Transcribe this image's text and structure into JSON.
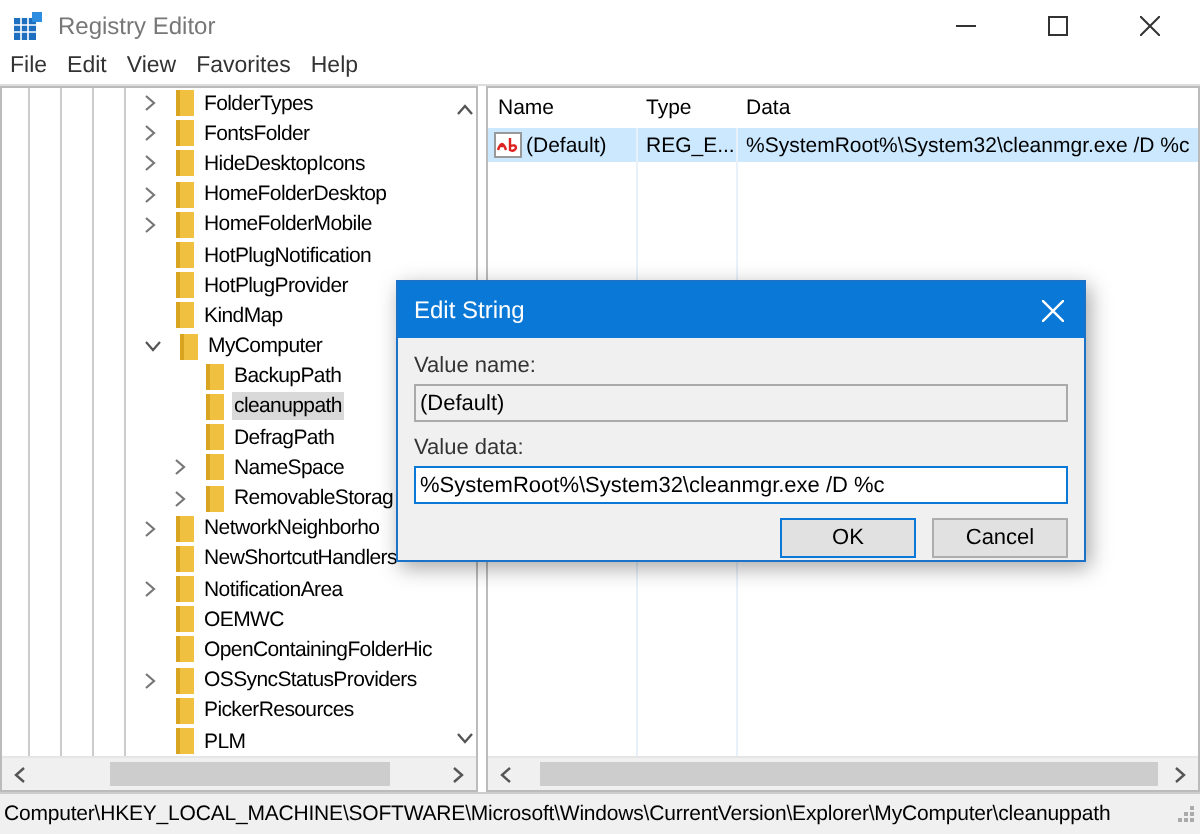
{
  "window": {
    "title": "Registry Editor"
  },
  "menu": [
    "File",
    "Edit",
    "View",
    "Favorites",
    "Help"
  ],
  "tree": {
    "items": [
      {
        "label": "FolderTypes",
        "expandable": true,
        "expanded": false,
        "selected": false
      },
      {
        "label": "FontsFolder",
        "expandable": true,
        "expanded": false,
        "selected": false
      },
      {
        "label": "HideDesktopIcons",
        "expandable": true,
        "expanded": false,
        "selected": false
      },
      {
        "label": "HomeFolderDesktop",
        "expandable": true,
        "expanded": false,
        "selected": false
      },
      {
        "label": "HomeFolderMobile",
        "expandable": true,
        "expanded": false,
        "selected": false
      },
      {
        "label": "HotPlugNotification",
        "expandable": false,
        "expanded": false,
        "selected": false
      },
      {
        "label": "HotPlugProvider",
        "expandable": false,
        "expanded": false,
        "selected": false
      },
      {
        "label": "KindMap",
        "expandable": false,
        "expanded": false,
        "selected": false
      },
      {
        "label": "MyComputer",
        "expandable": true,
        "expanded": true,
        "selected": false,
        "children": [
          {
            "label": "BackupPath",
            "expandable": false,
            "expanded": false,
            "selected": false
          },
          {
            "label": "cleanuppath",
            "expandable": false,
            "expanded": false,
            "selected": true
          },
          {
            "label": "DefragPath",
            "expandable": false,
            "expanded": false,
            "selected": false
          },
          {
            "label": "NameSpace",
            "expandable": true,
            "expanded": false,
            "selected": false
          },
          {
            "label": "RemovableStorag",
            "expandable": true,
            "expanded": false,
            "selected": false
          }
        ]
      },
      {
        "label": "NetworkNeighborho",
        "expandable": true,
        "expanded": false,
        "selected": false
      },
      {
        "label": "NewShortcutHandlers",
        "expandable": false,
        "expanded": false,
        "selected": false
      },
      {
        "label": "NotificationArea",
        "expandable": true,
        "expanded": false,
        "selected": false
      },
      {
        "label": "OEMWC",
        "expandable": false,
        "expanded": false,
        "selected": false
      },
      {
        "label": "OpenContainingFolderHic",
        "expandable": false,
        "expanded": false,
        "selected": false
      },
      {
        "label": "OSSyncStatusProviders",
        "expandable": true,
        "expanded": false,
        "selected": false
      },
      {
        "label": "PickerResources",
        "expandable": false,
        "expanded": false,
        "selected": false
      },
      {
        "label": "PLM",
        "expandable": false,
        "expanded": false,
        "selected": false
      }
    ]
  },
  "values": {
    "columns": [
      "Name",
      "Type",
      "Data"
    ],
    "rows": [
      {
        "name": "(Default)",
        "type": "REG_E...",
        "data": "%SystemRoot%\\System32\\cleanmgr.exe /D %c",
        "selected": true
      }
    ]
  },
  "dialog": {
    "title": "Edit String",
    "name_label": "Value name:",
    "name_value": "(Default)",
    "data_label": "Value data:",
    "data_value": "%SystemRoot%\\System32\\cleanmgr.exe /D %c",
    "buttons": [
      "OK",
      "Cancel"
    ]
  },
  "status_bar": "Computer\\HKEY_LOCAL_MACHINE\\SOFTWARE\\Microsoft\\Windows\\CurrentVersion\\Explorer\\MyComputer\\cleanuppath"
}
